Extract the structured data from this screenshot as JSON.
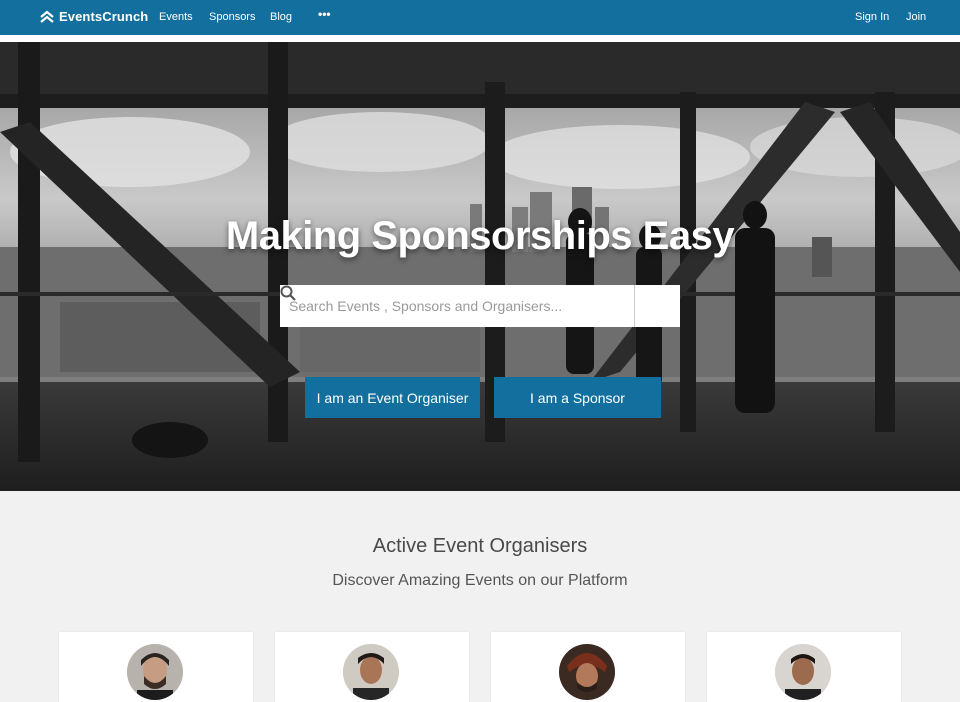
{
  "brand": {
    "name": "EventsCrunch",
    "accent": "#136f9e"
  },
  "nav": {
    "links": [
      "Events",
      "Sponsors",
      "Blog"
    ],
    "more": "•••",
    "sign_in": "Sign In",
    "join": "Join"
  },
  "hero": {
    "title": "Making Sponsorships Easy",
    "search_placeholder": "Search Events , Sponsors and Organisers...",
    "search_icon": "search-icon",
    "organiser_button": "I am an Event Organiser",
    "sponsor_button": "I am a Sponsor"
  },
  "section": {
    "title": "Active Event Organisers",
    "subtitle": "Discover Amazing Events on our Platform"
  },
  "organisers": [
    {
      "avatar": "avatar-photo"
    },
    {
      "avatar": "avatar-photo"
    },
    {
      "avatar": "avatar-photo"
    },
    {
      "avatar": "avatar-photo"
    }
  ]
}
